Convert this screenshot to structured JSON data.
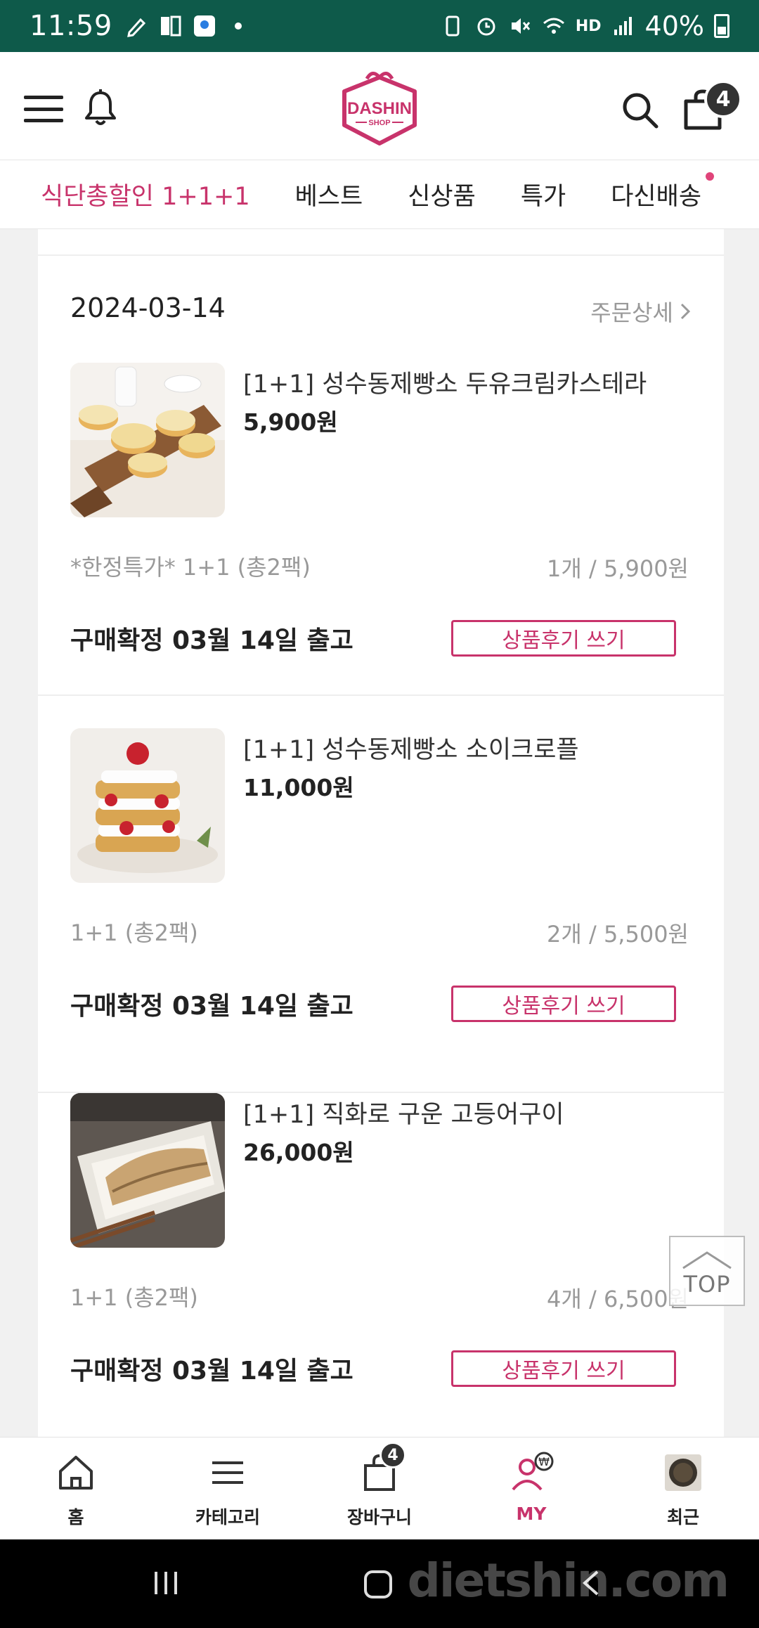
{
  "status_bar": {
    "time": "11:59",
    "battery": "40%",
    "hd_label": "HD"
  },
  "header": {
    "logo_text": "DASHIN",
    "logo_sub": "SHOP",
    "cart_count": "4"
  },
  "tabs": [
    {
      "label": "식단총할인 1+1+1",
      "active": true
    },
    {
      "label": "베스트"
    },
    {
      "label": "신상품"
    },
    {
      "label": "특가"
    },
    {
      "label": "다신배송",
      "dot": true
    }
  ],
  "order": {
    "date": "2024-03-14",
    "detail_link": "주문상세",
    "items": [
      {
        "name": "[1+1] 성수동제빵소 두유크림카스테라",
        "price": "5,900원",
        "option": "*한정특가* 1+1 (총2팩)",
        "qty": "1개 / 5,900원",
        "status": "구매확정  03월 14일 출고",
        "review_label": "상품후기 쓰기"
      },
      {
        "name": "[1+1] 성수동제빵소 소이크로플",
        "price": "11,000원",
        "option": "1+1 (총2팩)",
        "qty": "2개 / 5,500원",
        "status": "구매확정  03월 14일 출고",
        "review_label": "상품후기 쓰기"
      },
      {
        "name": "[1+1] 직화로 구운 고등어구이",
        "price": "26,000원",
        "option": "1+1 (총2팩)",
        "qty": "4개 / 6,500원",
        "status": "구매확정  03월 14일 출고",
        "review_label": "상품후기 쓰기"
      }
    ]
  },
  "top_button": "TOP",
  "bottom_nav": {
    "home": "홈",
    "category": "카테고리",
    "cart": "장바구니",
    "cart_count": "4",
    "my": "MY",
    "recent": "최근"
  },
  "watermark": "dietshin.com",
  "colors": {
    "accent": "#c8336b",
    "status_bar": "#0e5a4a"
  }
}
